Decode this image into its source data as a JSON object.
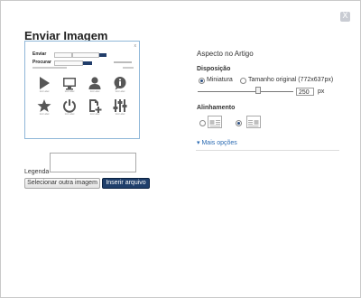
{
  "dialog": {
    "title": "Enviar Imagem",
    "close_label": "X"
  },
  "preview": {
    "close_label": "x",
    "title": "Enviar",
    "subtitle": "Procurar",
    "icons": [
      {
        "name": "play-icon",
        "label": "Icon Label"
      },
      {
        "name": "monitor-icon",
        "label": "Icon Label"
      },
      {
        "name": "user-icon",
        "label": "Icon Label"
      },
      {
        "name": "info-icon",
        "label": "Icon Label"
      },
      {
        "name": "star-icon",
        "label": "Icon Label"
      },
      {
        "name": "power-icon",
        "label": "Icon Label"
      },
      {
        "name": "new-document-icon",
        "label": "Icon Label"
      },
      {
        "name": "equalizer-icon",
        "label": "Icon Label"
      }
    ]
  },
  "legend": {
    "label": "Legenda",
    "value": ""
  },
  "buttons": {
    "select_other": "Selecionar outra imagem",
    "insert": "Inserir arquivo"
  },
  "settings": {
    "title": "Aspecto no Artigo",
    "layout_label": "Disposição",
    "thumbnail_label": "Miniatura",
    "original_label": "Tamanho original (772x637px)",
    "layout_selected": "Miniatura",
    "size_value": "250",
    "size_unit": "px",
    "align_label": "Alinhamento",
    "align_selected": "right",
    "more_options": "Mais opções"
  },
  "colors": {
    "primary_button": "#1f3f6b",
    "preview_border": "#8fb7d8",
    "link": "#2a6ab2"
  }
}
